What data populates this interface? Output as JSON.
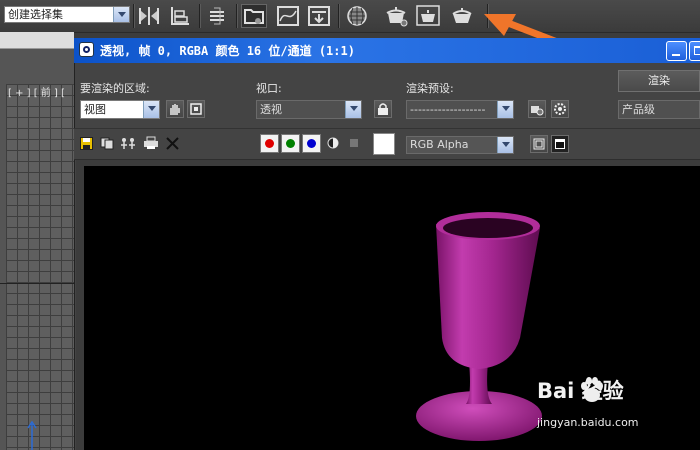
{
  "main_toolbar": {
    "selection_set_value": "创建选择集",
    "buttons": [
      "mirror-icon",
      "align-icon",
      "layer-manager-icon",
      "schematic-view-icon",
      "curve-editor-icon",
      "material-editor-icon",
      "render-setup-icon",
      "rendered-frame-window-icon",
      "render-production-icon",
      "render-iterative-icon"
    ]
  },
  "viewport": {
    "label": "[ + ] [ 前 ] [",
    "axis_color": "#2b6bd6"
  },
  "render_window": {
    "title": "透视, 帧 0, RGBA 颜色 16 位/通道 (1:1)",
    "area_label": "要渲染的区域:",
    "area_value": "视图",
    "viewport_label": "视口:",
    "viewport_value": "透视",
    "preset_label": "渲染预设:",
    "preset_value": "-------------------",
    "render_button": "渲染",
    "quality_value": "产品级",
    "channel_value": "RGB Alpha",
    "channel_colors": {
      "red": "#e00000",
      "green": "#008000",
      "blue": "#0000d0"
    },
    "swatch_color": "#ffffff",
    "background_color": "#000000"
  },
  "scene": {
    "object": "goblet",
    "color": "#a0208c"
  },
  "annotation": {
    "arrow_color": "#f0752a"
  },
  "watermark": {
    "logo": "Bai  经验",
    "url": "jingyan.baidu.com"
  }
}
